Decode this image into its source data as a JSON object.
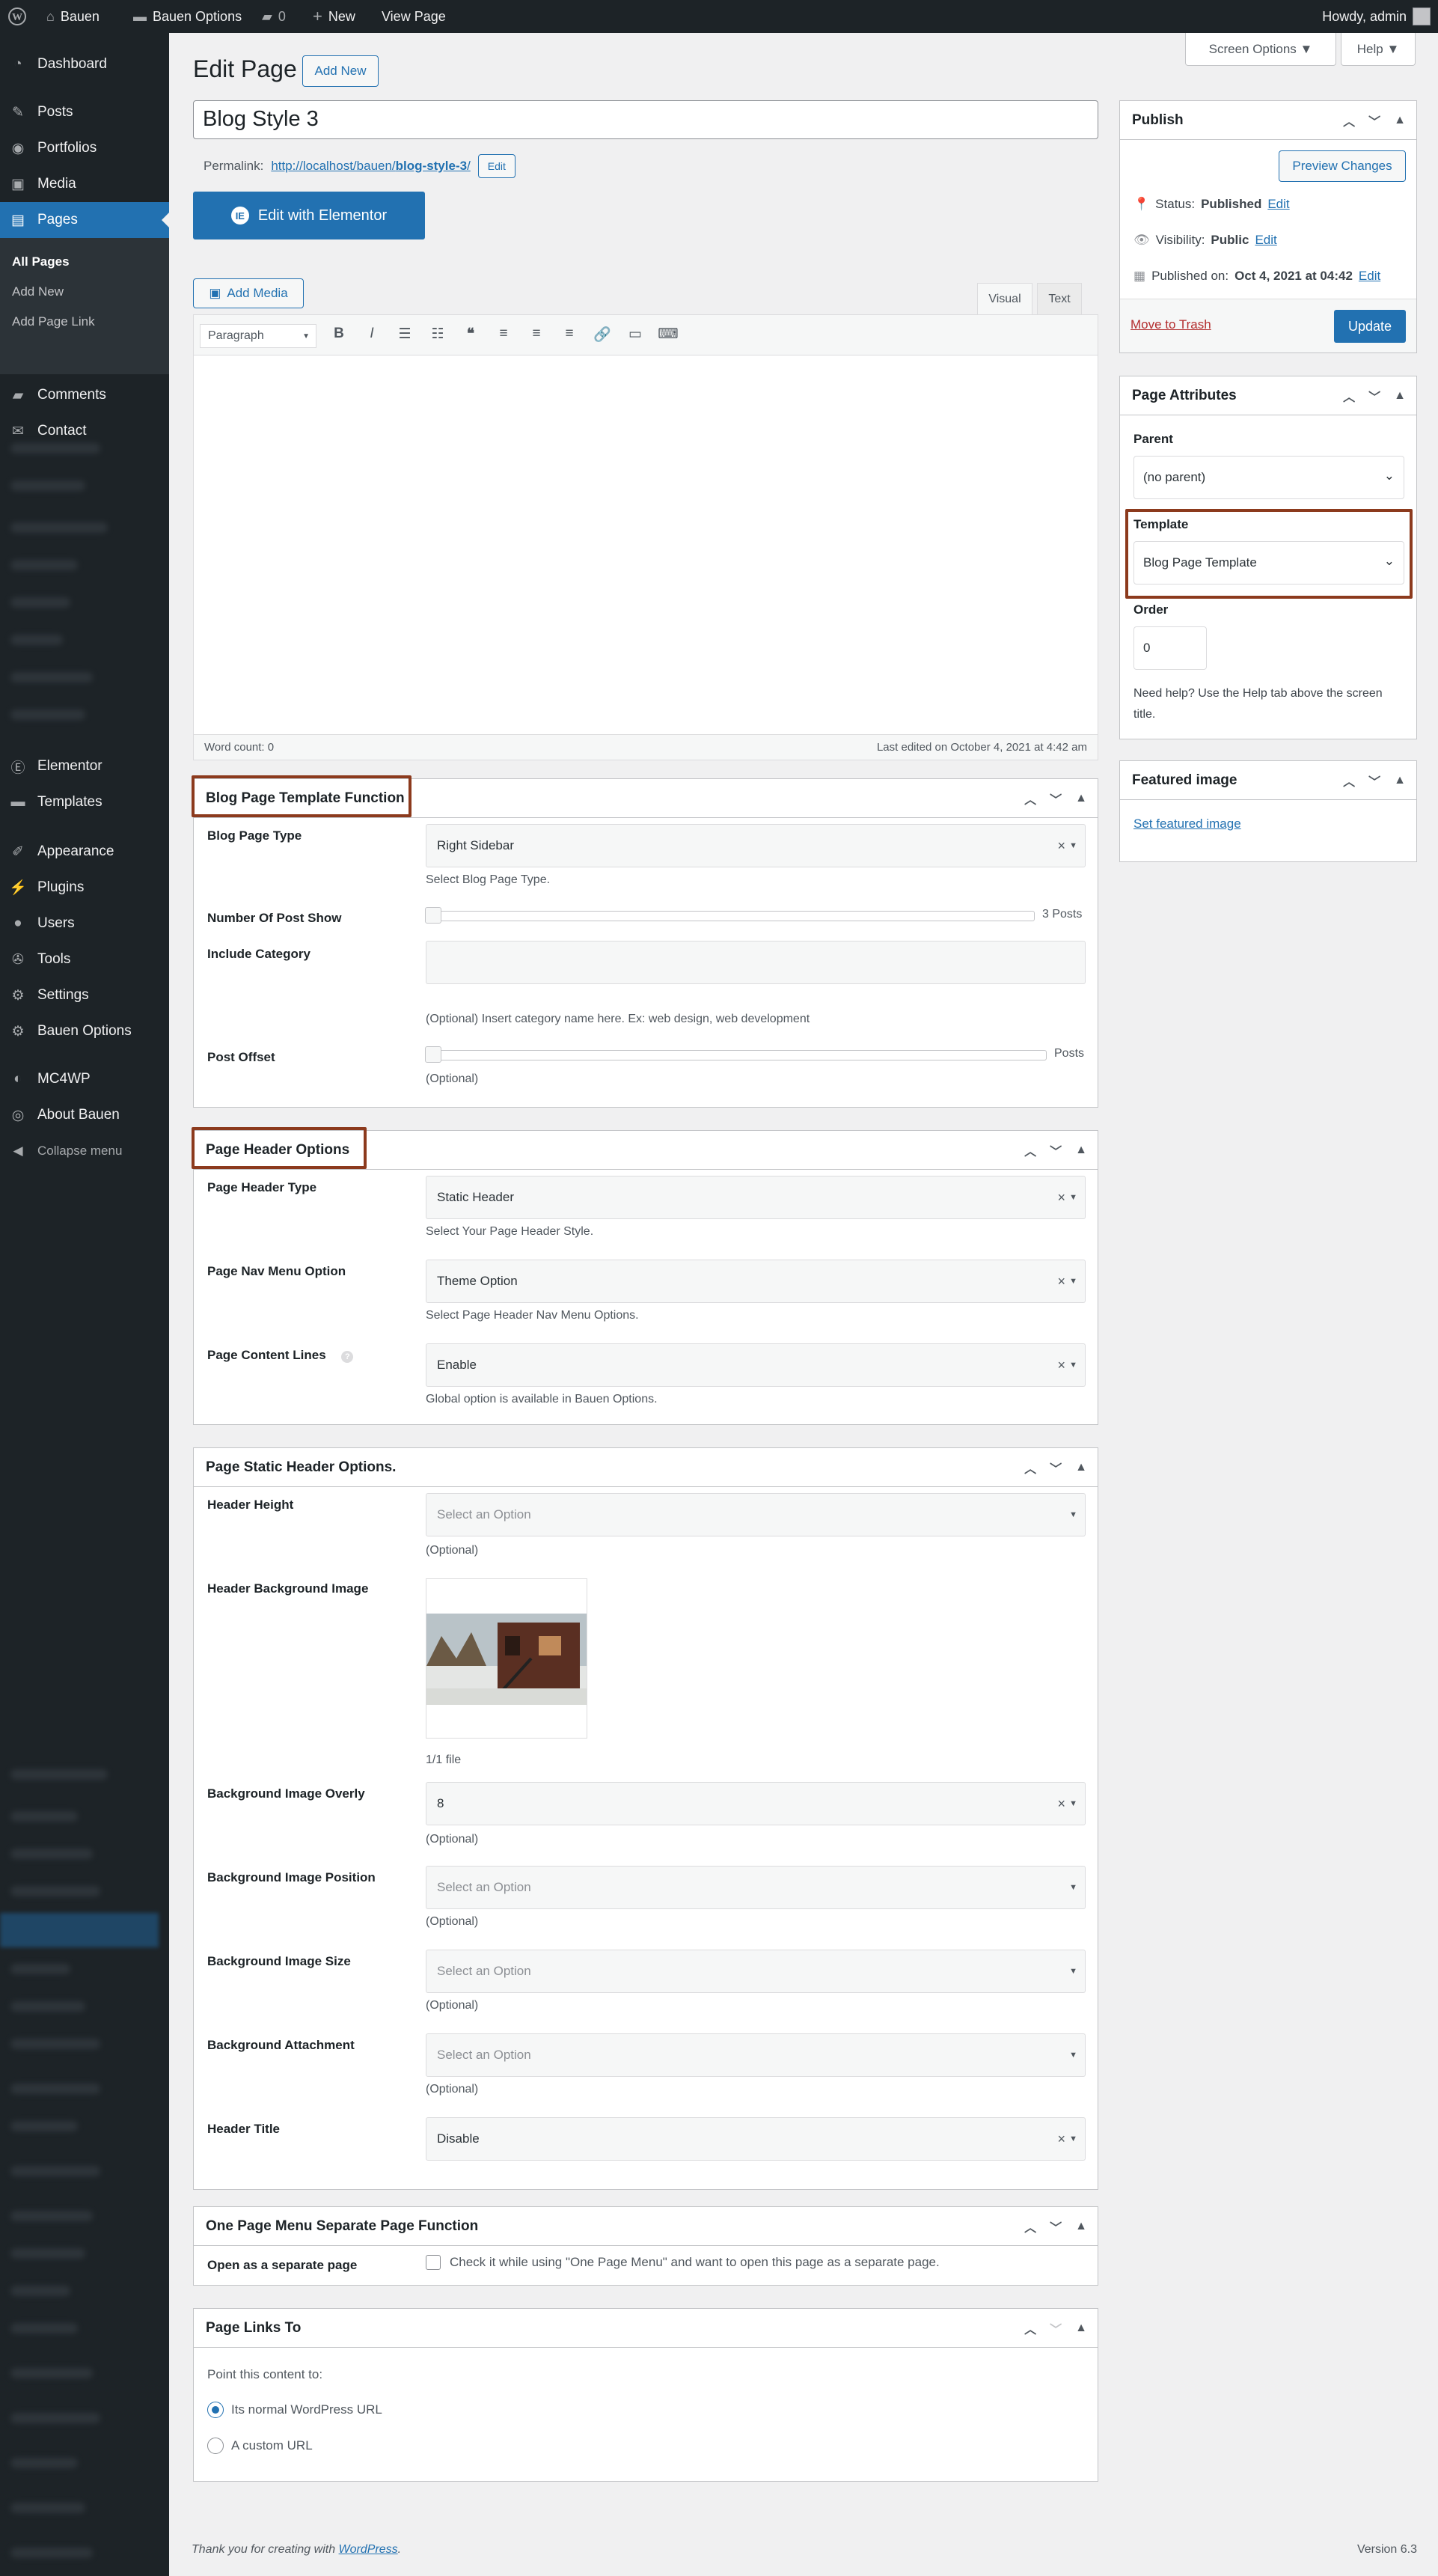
{
  "adminbar": {
    "site": "Bauen",
    "options": "Bauen Options",
    "comments": "0",
    "new": "New",
    "view": "View Page",
    "howdy": "Howdy, admin"
  },
  "sidebar": {
    "dashboard": "Dashboard",
    "posts": "Posts",
    "portfolios": "Portfolios",
    "media": "Media",
    "pages": "Pages",
    "sub_all": "All Pages",
    "sub_new": "Add New",
    "sub_link": "Add Page Link",
    "comments": "Comments",
    "contact": "Contact",
    "elementor": "Elementor",
    "templates": "Templates",
    "appearance": "Appearance",
    "plugins": "Plugins",
    "users": "Users",
    "tools": "Tools",
    "settings": "Settings",
    "bauen": "Bauen Options",
    "mc4wp": "MC4WP",
    "about": "About Bauen",
    "collapse": "Collapse menu"
  },
  "header": {
    "title": "Edit Page",
    "add_new": "Add New",
    "screen_options": "Screen Options",
    "help": "Help"
  },
  "post": {
    "title": "Blog Style 3",
    "permalink_label": "Permalink:",
    "permalink_base": "http://localhost/bauen/",
    "permalink_slug": "blog-style-3",
    "permalink_end": "/",
    "edit": "Edit",
    "elementor_btn": "Edit with Elementor"
  },
  "editor": {
    "add_media": "Add Media",
    "tab_visual": "Visual",
    "tab_text": "Text",
    "format": "Paragraph",
    "word_count": "Word count: 0",
    "last_edited": "Last edited on October 4, 2021 at 4:42 am"
  },
  "blog_box": {
    "title": "Blog Page Template Function",
    "type_label": "Blog Page Type",
    "type_value": "Right Sidebar",
    "type_help": "Select Blog Page Type.",
    "num_label": "Number Of Post Show",
    "num_value": "3 Posts",
    "cat_label": "Include Category",
    "cat_help": "(Optional) Insert category name here. Ex: web design, web development",
    "offset_label": "Post Offset",
    "offset_unit": "Posts",
    "offset_help": "(Optional)"
  },
  "header_box": {
    "title": "Page Header Options",
    "type_label": "Page Header Type",
    "type_value": "Static Header",
    "type_help": "Select Your Page Header Style.",
    "nav_label": "Page Nav Menu Option",
    "nav_value": "Theme Option",
    "nav_help": "Select Page Header Nav Menu Options.",
    "lines_label": "Page Content Lines",
    "lines_value": "Enable",
    "lines_help": "Global option is available in Bauen Options."
  },
  "static_box": {
    "title": "Page Static Header Options.",
    "height_label": "Header Height",
    "placeholder": "Select an Option",
    "optional": "(Optional)",
    "bg_label": "Header Background Image",
    "file_count": "1/1 file",
    "overly_label": "Background Image Overly",
    "overly_value": "8",
    "pos_label": "Background Image Position",
    "size_label": "Background Image Size",
    "attach_label": "Background Attachment",
    "title_label": "Header Title",
    "title_value": "Disable"
  },
  "onepage_box": {
    "title": "One Page Menu Separate Page Function",
    "label": "Open as a separate page",
    "text": "Check it while using \"One Page Menu\" and want to open this page as a separate page."
  },
  "links_box": {
    "title": "Page Links To",
    "point": "Point this content to:",
    "opt1": "Its normal WordPress URL",
    "opt2": "A custom URL"
  },
  "publish": {
    "title": "Publish",
    "preview": "Preview Changes",
    "status_label": "Status:",
    "status_value": "Published",
    "visibility_label": "Visibility:",
    "visibility_value": "Public",
    "published_label": "Published on:",
    "published_value": "Oct 4, 2021 at 04:42",
    "edit": "Edit",
    "trash": "Move to Trash",
    "update": "Update"
  },
  "attributes": {
    "title": "Page Attributes",
    "parent_label": "Parent",
    "parent_value": "(no parent)",
    "template_label": "Template",
    "template_value": "Blog Page Template",
    "order_label": "Order",
    "order_value": "0",
    "help": "Need help? Use the Help tab above the screen title."
  },
  "featured": {
    "title": "Featured image",
    "set": "Set featured image"
  },
  "footer": {
    "thanks": "Thank you for creating with",
    "wp": "WordPress",
    "version": "Version 6.3"
  },
  "colors": {
    "accent": "#2271b1",
    "highlight": "#8c3a1d",
    "sidebar": "#1d2327"
  }
}
